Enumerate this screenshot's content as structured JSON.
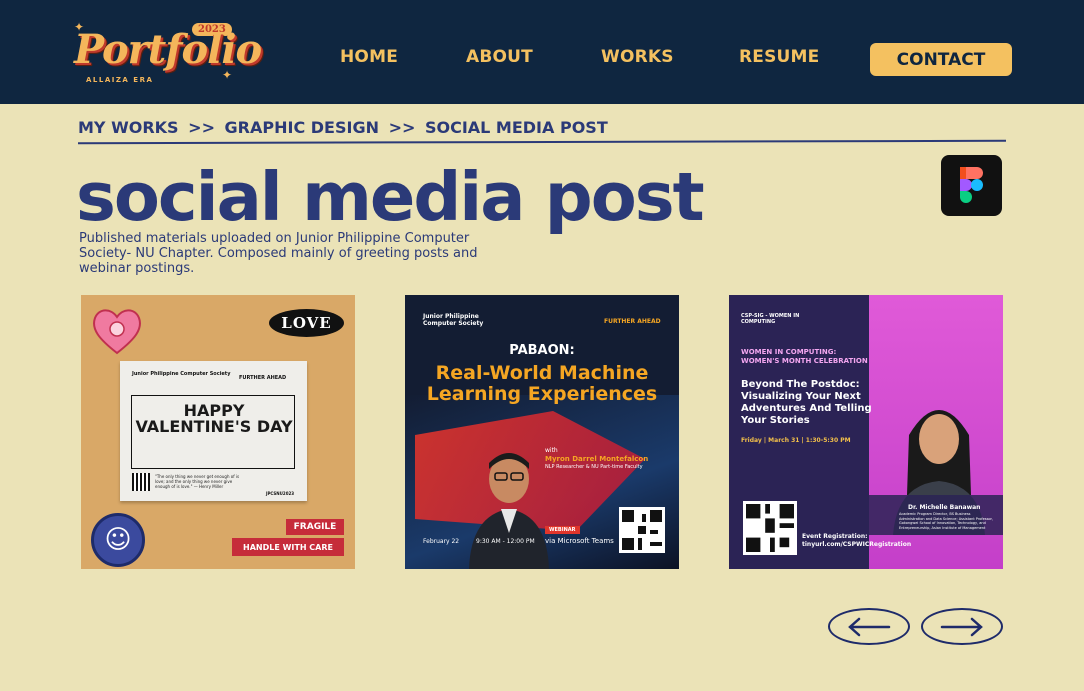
{
  "logo": {
    "text": "Portfolio",
    "year": "2023",
    "subtitle": "ALLAIZA ERA"
  },
  "nav": {
    "home": "HOME",
    "about": "ABOUT",
    "works": "WORKS",
    "resume": "RESUME",
    "contact": "CONTACT"
  },
  "breadcrumb": {
    "level1": "MY WORKS",
    "sep1": ">>",
    "level2": "GRAPHIC DESIGN",
    "sep2": ">>",
    "level3": "SOCIAL MEDIA POST"
  },
  "page": {
    "title": "social media post",
    "description": "Published materials uploaded on Junior Philippine Computer Society- NU Chapter. Composed mainly of greeting posts and webinar postings."
  },
  "tool_icon": "figma-icon",
  "cards": [
    {
      "org": "Junior Philippine Computer Society",
      "further": "FURTHER AHEAD",
      "love": "LOVE",
      "greeting": "HAPPY VALENTINE'S DAY",
      "quote": "\"The only thing we never get enough of is love; and the only thing we never give enough of is love.\" — Henry Miller",
      "tag": "JPCSNU2023",
      "fragile": "FRAGILE",
      "handle": "HANDLE WITH CARE"
    },
    {
      "org": "Junior Philippine Computer Society",
      "further": "FURTHER AHEAD",
      "series": "PABAON:",
      "headline": "Real-World Machine Learning Experiences",
      "with": "with",
      "speaker": "Myron Darrel Montefalcon",
      "role": "NLP Researcher & NU Part-time Faculty",
      "webinar": "WEBINAR",
      "platform": "via Microsoft Teams",
      "date": "February 22",
      "time": "9:30 AM - 12:00 PM"
    },
    {
      "org": "CSP-SIG - WOMEN IN COMPUTING",
      "event": "WOMEN IN COMPUTING: WOMEN'S MONTH CELEBRATION",
      "headline": "Beyond The Postdoc: Visualizing Your Next Adventures And Telling Your Stories",
      "when": "Friday | March 31 | 1:30-5:30 PM",
      "registration": "Event Registration:",
      "link": "tinyurl.com/CSPWICRegistration",
      "speaker": "Dr. Michelle Banawan",
      "role": "Academic Program Director, BS Business Administration and Data Science; Assistant Professor, Gokongwei School of Innovation, Technology, and Entrepreneurship, Asian Institute of Management"
    }
  ],
  "carousel": {
    "prev_icon": "arrow-left-icon",
    "next_icon": "arrow-right-icon"
  },
  "colors": {
    "header_bg": "#0f2640",
    "page_bg": "#ebe3b7",
    "accent": "#f4c160",
    "ink": "#2b3a78"
  }
}
